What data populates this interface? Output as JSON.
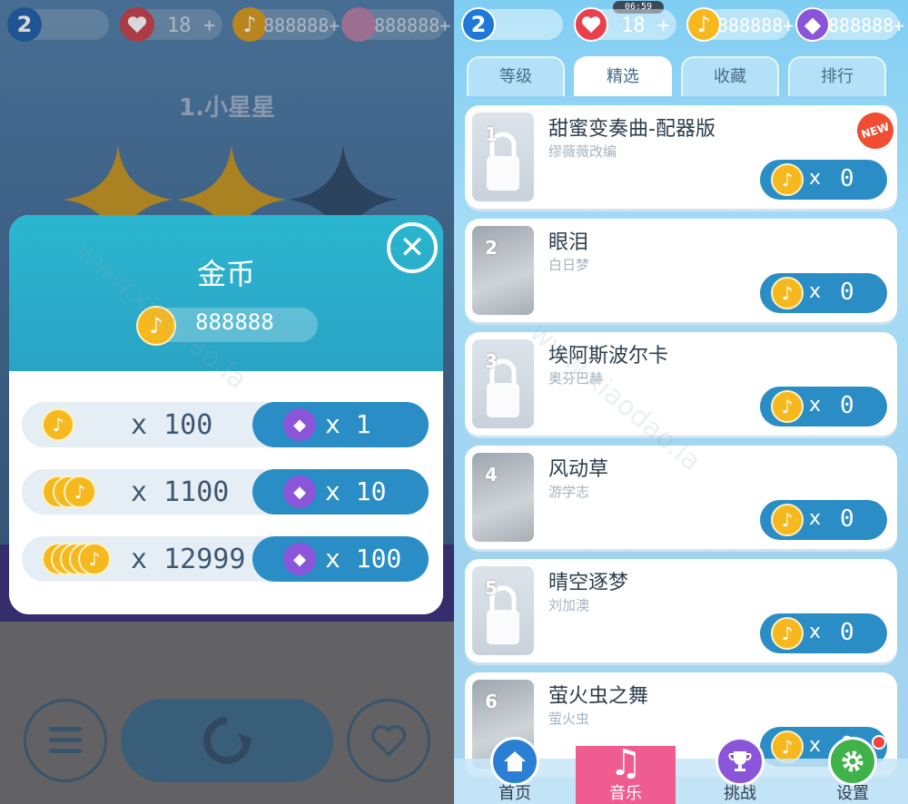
{
  "left": {
    "status": {
      "level": "2",
      "lives": "18",
      "plus": "+",
      "coins": "888888+",
      "gems": "888888+"
    },
    "song_title": "1.小星星",
    "modal": {
      "title": "金币",
      "balance": "888888",
      "packs": [
        {
          "amount": "x 100",
          "price": "x 1"
        },
        {
          "amount": "x 1100",
          "price": "x 10"
        },
        {
          "amount": "x 12999",
          "price": "x 100"
        }
      ]
    },
    "colors": {
      "coin": "#f6b81f",
      "gem": "#8b55d9",
      "buy": "#2a8dc6",
      "header": "#2ab6cf"
    }
  },
  "right": {
    "clock": "06:59",
    "status": {
      "level": "2",
      "lives": "18",
      "plus": "+",
      "coins": "888888+",
      "gems": "888888+"
    },
    "tabs": [
      "等级",
      "精选",
      "收藏",
      "排行"
    ],
    "active_tab": "精选",
    "songs": [
      {
        "index": "1",
        "title": "甜蜜变奏曲-配器版",
        "author": "缪薇薇改编",
        "x": "x",
        "price": "0",
        "badge": "NEW"
      },
      {
        "index": "2",
        "title": "眼泪",
        "author": "白日梦",
        "x": "x",
        "price": "0"
      },
      {
        "index": "3",
        "title": "埃阿斯波尔卡",
        "author": "奥芬巴赫",
        "x": "x",
        "price": "0"
      },
      {
        "index": "4",
        "title": "风动草",
        "author": "游学志",
        "x": "x",
        "price": "0"
      },
      {
        "index": "5",
        "title": "晴空逐梦",
        "author": "刘加澳",
        "x": "x",
        "price": "0"
      },
      {
        "index": "6",
        "title": "萤火虫之舞",
        "author": "萤火虫",
        "x": "x",
        "price": "0"
      }
    ],
    "nav": [
      {
        "label": "首页",
        "icon": "home-icon"
      },
      {
        "label": "音乐",
        "icon": "music-note-icon"
      },
      {
        "label": "挑战",
        "icon": "trophy-icon"
      },
      {
        "label": "设置",
        "icon": "gear-icon"
      }
    ],
    "active_nav": "音乐"
  },
  "watermark": "www.xiaodao.la"
}
